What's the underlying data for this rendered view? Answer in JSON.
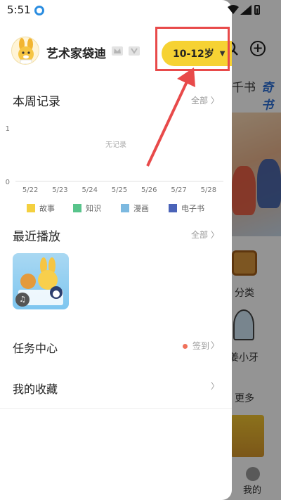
{
  "status": {
    "time": "5:51"
  },
  "background": {
    "tab_partial": "千书",
    "tab_active": "奇书",
    "category_label": "分类",
    "character_label": "姜小牙",
    "more_label": "更多",
    "bottom_nav_label": "我的"
  },
  "profile": {
    "nickname": "艺术家袋迪",
    "age_selector": "10-12岁"
  },
  "weekly": {
    "title": "本周记录",
    "more": "全部",
    "empty_text": "无记录"
  },
  "chart_data": {
    "type": "bar",
    "categories": [
      "5/22",
      "5/23",
      "5/24",
      "5/25",
      "5/26",
      "5/27",
      "5/28"
    ],
    "series": [
      {
        "name": "故事",
        "values": [
          0,
          0,
          0,
          0,
          0,
          0,
          0
        ],
        "color": "#f4d03f"
      },
      {
        "name": "知识",
        "values": [
          0,
          0,
          0,
          0,
          0,
          0,
          0
        ],
        "color": "#58c48b"
      },
      {
        "name": "漫画",
        "values": [
          0,
          0,
          0,
          0,
          0,
          0,
          0
        ],
        "color": "#7cb9e0"
      },
      {
        "name": "电子书",
        "values": [
          0,
          0,
          0,
          0,
          0,
          0,
          0
        ],
        "color": "#4a63b8"
      }
    ],
    "y_ticks": [
      "0",
      "1"
    ],
    "ylim": [
      0,
      1
    ],
    "grid": false,
    "legend": "bottom"
  },
  "recent": {
    "title": "最近播放",
    "more": "全部"
  },
  "tasks": {
    "label": "任务中心",
    "sign_in": "签到"
  },
  "favorites": {
    "label": "我的收藏"
  },
  "chevron": "〉"
}
